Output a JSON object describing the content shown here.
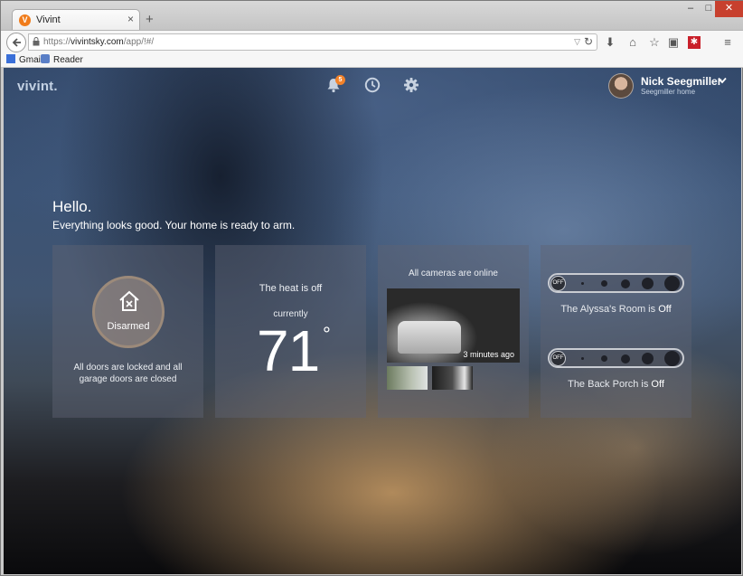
{
  "browser": {
    "tab_title": "Vivint",
    "tab_favicon_letter": "V",
    "tab_close": "×",
    "new_tab": "+",
    "url_prefix": "https://",
    "url_host": "vivintsky.com",
    "url_path": "/app/!#/",
    "bookmarks": [
      {
        "label": "Gmail"
      },
      {
        "label": "Reader"
      }
    ],
    "window_controls": {
      "minimize": "–",
      "maximize": "□",
      "close": "✕"
    }
  },
  "app": {
    "logo": "vivint.",
    "notification_count": "5",
    "user": {
      "name": "Nick Seegmiller",
      "home": "Seegmiller home"
    },
    "greeting": "Hello.",
    "status_message": "Everything looks good. Your home is ready to arm."
  },
  "cards": {
    "security": {
      "state_label": "Disarmed",
      "description": "All doors are locked and all garage doors are closed"
    },
    "thermostat": {
      "status": "The heat is off",
      "currently_label": "currently",
      "temperature": "71",
      "degree_symbol": "°"
    },
    "cameras": {
      "status": "All cameras are online",
      "last_updated": "3 minutes ago"
    },
    "lights": [
      {
        "off_label": "OFF",
        "room": "The Alyssa's Room is",
        "state": "Off"
      },
      {
        "off_label": "OFF",
        "room": "The Back Porch is",
        "state": "Off"
      }
    ]
  },
  "colors": {
    "accent": "#f2822a",
    "close_button": "#c7402e"
  }
}
